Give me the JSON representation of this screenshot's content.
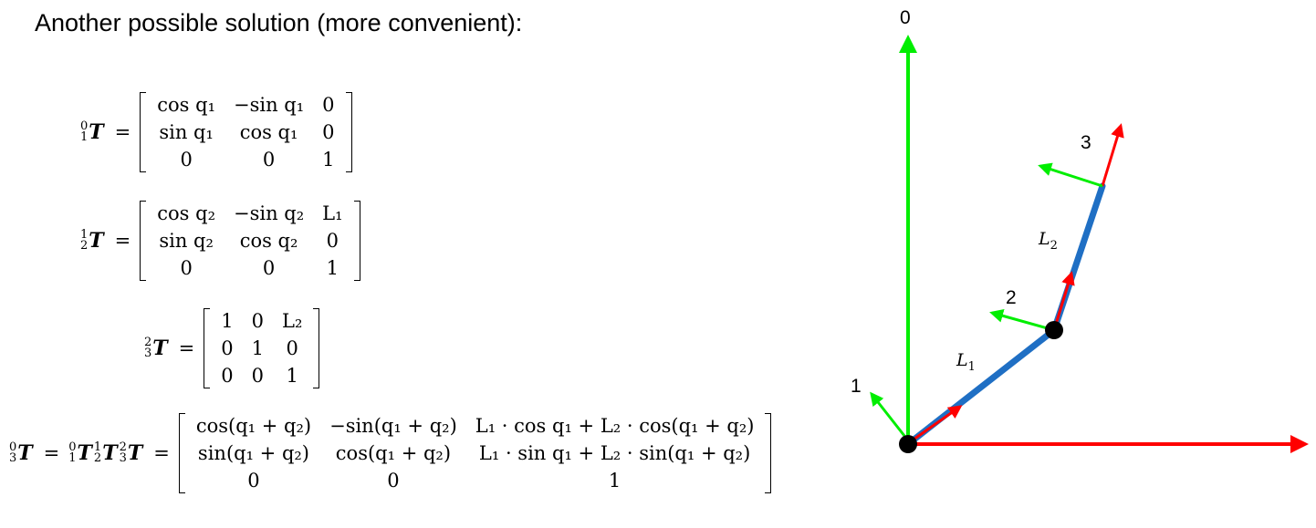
{
  "heading": "Another possible solution (more convenient):",
  "equations": [
    {
      "lhs": [
        {
          "sup": "0",
          "sub": "1",
          "sym": "T"
        }
      ],
      "matrix": [
        [
          "cos q₁",
          "−sin q₁",
          "0"
        ],
        [
          "sin q₁",
          "cos q₁",
          "0"
        ],
        [
          "0",
          "0",
          "1"
        ]
      ]
    },
    {
      "lhs": [
        {
          "sup": "1",
          "sub": "2",
          "sym": "T"
        }
      ],
      "matrix": [
        [
          "cos q₂",
          "−sin q₂",
          "L₁"
        ],
        [
          "sin q₂",
          "cos q₂",
          "0"
        ],
        [
          "0",
          "0",
          "1"
        ]
      ]
    },
    {
      "lhs": [
        {
          "sup": "2",
          "sub": "3",
          "sym": "T"
        }
      ],
      "matrix": [
        [
          "1",
          "0",
          "L₂"
        ],
        [
          "0",
          "1",
          "0"
        ],
        [
          "0",
          "0",
          "1"
        ]
      ]
    },
    {
      "lhs": [
        {
          "sup": "0",
          "sub": "3",
          "sym": "T"
        },
        {
          "text": "="
        },
        {
          "sup": "0",
          "sub": "1",
          "sym": "T"
        },
        {
          "sup": "1",
          "sub": "2",
          "sym": "T"
        },
        {
          "sup": "2",
          "sub": "3",
          "sym": "T"
        }
      ],
      "matrix": [
        [
          "cos(q₁ + q₂)",
          "−sin(q₁ + q₂)",
          "L₁ · cos q₁ + L₂ · cos(q₁ + q₂)"
        ],
        [
          "sin(q₁ + q₂)",
          "cos(q₁ + q₂)",
          "L₁ · sin q₁ + L₂ · sin(q₁ + q₂)"
        ],
        [
          "0",
          "0",
          "1"
        ]
      ]
    }
  ],
  "diagram": {
    "frame_labels": [
      "0",
      "1",
      "2",
      "3"
    ],
    "link_labels": [
      {
        "main": "L",
        "sub": "1"
      },
      {
        "main": "L",
        "sub": "2"
      }
    ],
    "colors": {
      "x_axis": "#ff0000",
      "y_axis": "#00ee00",
      "link": "#1f6fc4",
      "joint": "#000000"
    }
  }
}
